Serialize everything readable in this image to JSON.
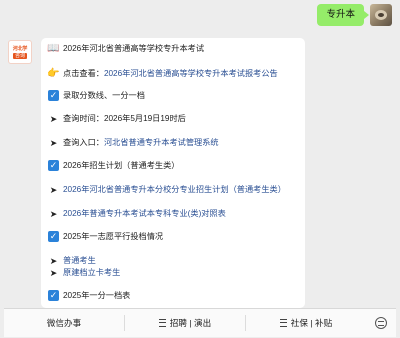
{
  "chat": {
    "user_message": "专升本",
    "bot_avatar_line1": "河北学",
    "bot_avatar_line2": "咨询"
  },
  "card": {
    "title": "2026年河北省普通高等学校专升本考试",
    "click_view_prefix": "点击查看：",
    "click_view_link": "2026年河北省普通高等学校专升本考试报考公告",
    "section_admission": "录取分数线、一分一档",
    "query_time": "查询时间：2026年5月19日19时后",
    "query_entry_prefix": "查询入口：",
    "query_entry_link": "河北省普通专升本考试管理系统",
    "section_plan": "2026年招生计划（普通考生类）",
    "plan_link_1": "2026年河北省普通专升本分校分专业招生计划（普通考生类）",
    "plan_link_2": "2026年普通专升本考试本专科专业(类)对照表",
    "section_volunteer": "2025年一志愿平行投档情况",
    "volunteer_link_1": "普通考生",
    "volunteer_link_2": "原建档立卡考生",
    "section_score": "2025年一分一档表"
  },
  "bottom_menu": {
    "item1": "微信办事",
    "item2": "招聘 | 演出",
    "item3": "社保 | 补贴"
  },
  "icons": {
    "book": "open-book-icon",
    "hand": "pointing-hand-icon",
    "check": "checkbox-icon",
    "arrow": "arrow-right-icon",
    "menu": "hamburger-icon",
    "keyboard": "keyboard-toggle-icon"
  }
}
